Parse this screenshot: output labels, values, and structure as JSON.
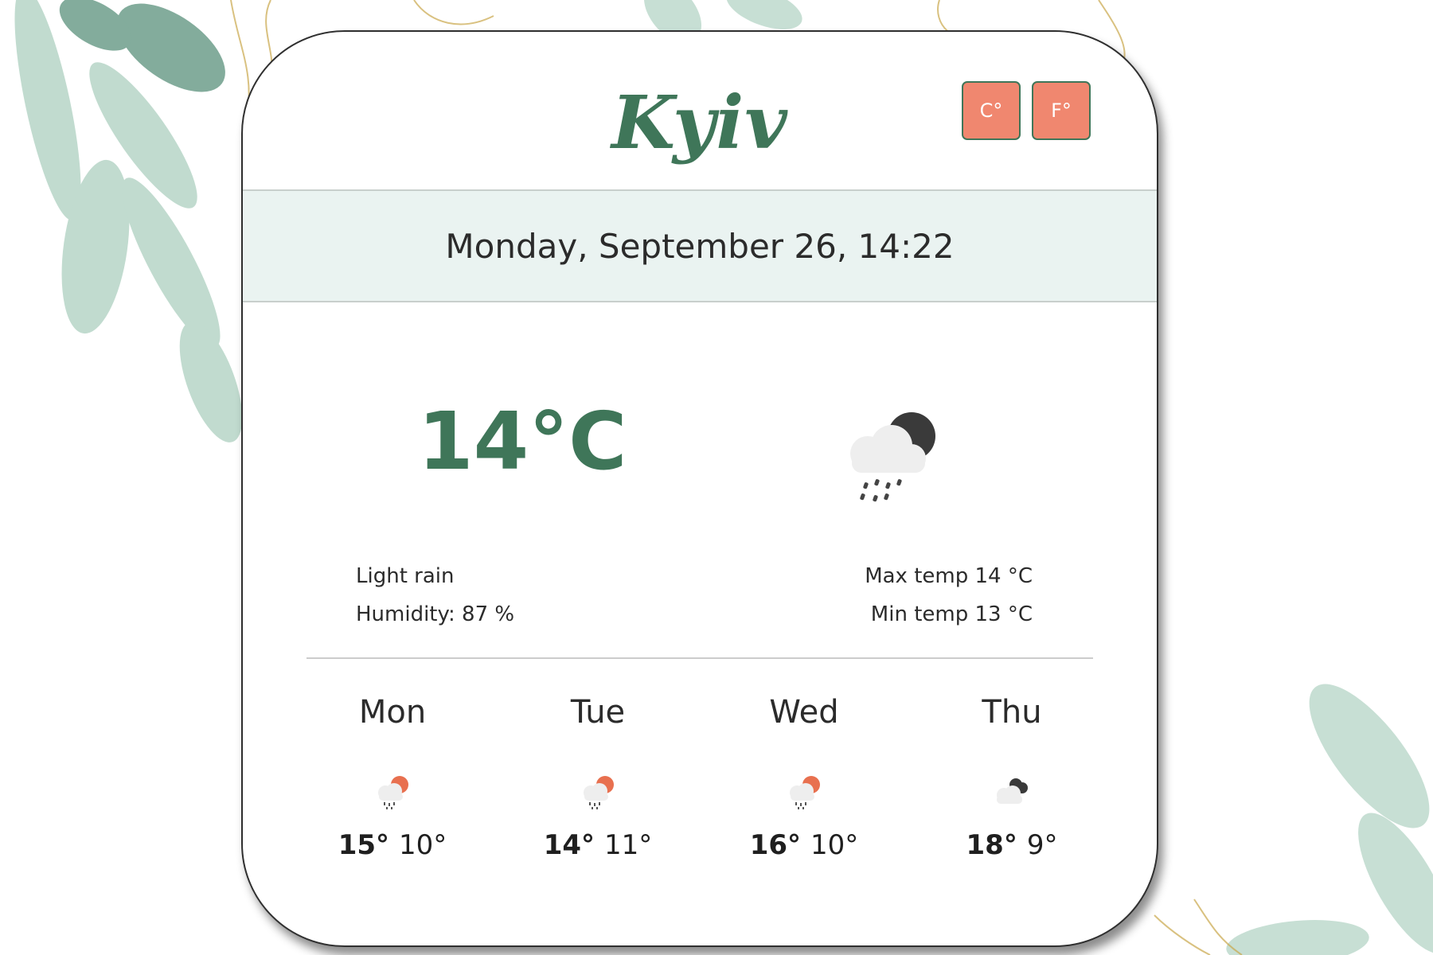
{
  "city": "Kyiv",
  "units": {
    "celsius_label": "C°",
    "fahrenheit_label": "F°"
  },
  "date": "Monday, September 26, 14:22",
  "current": {
    "temperature": "14°C",
    "description": "Light rain",
    "humidity": "Humidity: 87 %",
    "max_temp": "Max temp 14 °C",
    "min_temp": "Min temp 13 °C",
    "icon": "moon-cloud-rain-icon"
  },
  "forecast": [
    {
      "day": "Mon",
      "max": "15°",
      "min": "10°",
      "icon": "sun-cloud-rain-icon"
    },
    {
      "day": "Tue",
      "max": "14°",
      "min": "11°",
      "icon": "sun-cloud-rain-icon"
    },
    {
      "day": "Wed",
      "max": "16°",
      "min": "10°",
      "icon": "sun-cloud-rain-icon"
    },
    {
      "day": "Thu",
      "max": "18°",
      "min": "9°",
      "icon": "dark-clouds-icon"
    }
  ],
  "colors": {
    "accent_green": "#3f7659",
    "button_coral": "#f0876f",
    "date_band": "#eaf3f1",
    "text_dark": "#2b2b2b"
  }
}
